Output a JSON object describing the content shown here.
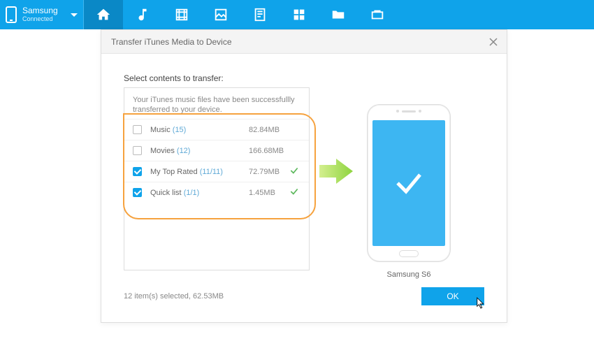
{
  "device": {
    "name": "Samsung",
    "status": "Connected"
  },
  "dialog": {
    "title": "Transfer iTunes Media to Device",
    "select_label": "Select contents to transfer:",
    "status_message": "Your iTunes music files have been successfullly transferred to your device.",
    "rows": [
      {
        "name": "Music",
        "count": "(15)",
        "size": "82.84MB",
        "checked": false,
        "done": false
      },
      {
        "name": "Movies",
        "count": "(12)",
        "size": "166.68MB",
        "checked": false,
        "done": false
      },
      {
        "name": "My Top Rated",
        "count": "(11/11)",
        "size": "72.79MB",
        "checked": true,
        "done": true
      },
      {
        "name": "Quick list",
        "count": "(1/1)",
        "size": "1.45MB",
        "checked": true,
        "done": true
      }
    ],
    "target_device": "Samsung S6",
    "summary": "12 item(s) selected, 62.53MB",
    "ok_label": "OK"
  }
}
